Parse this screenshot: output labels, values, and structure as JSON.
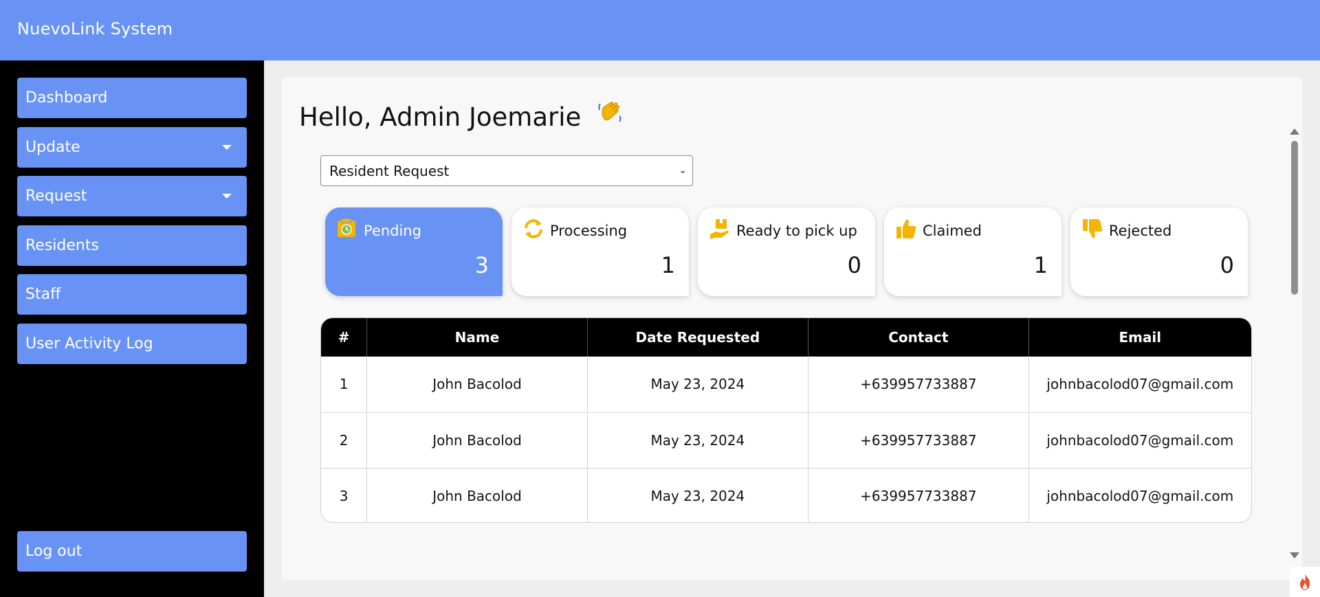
{
  "app": {
    "title": "NuevoLink System"
  },
  "sidebar": {
    "items": [
      {
        "label": "Dashboard",
        "has_caret": false
      },
      {
        "label": "Update",
        "has_caret": true
      },
      {
        "label": "Request",
        "has_caret": true
      },
      {
        "label": "Residents",
        "has_caret": false
      },
      {
        "label": "Staff",
        "has_caret": false
      },
      {
        "label": "User Activity Log",
        "has_caret": false
      }
    ],
    "logout_label": "Log out"
  },
  "main": {
    "greeting": "Hello, Admin Joemarie",
    "greeting_icon": "waving-hand-icon",
    "request_type": {
      "selected": "Resident Request"
    },
    "stats": [
      {
        "label": "Pending",
        "count": "3",
        "icon": "pending-clock-icon",
        "active": true
      },
      {
        "label": "Processing",
        "count": "1",
        "icon": "refresh-icon",
        "active": false
      },
      {
        "label": "Ready to pick up",
        "count": "0",
        "icon": "package-hand-icon",
        "active": false
      },
      {
        "label": "Claimed",
        "count": "1",
        "icon": "thumbs-up-icon",
        "active": false
      },
      {
        "label": "Rejected",
        "count": "0",
        "icon": "thumbs-down-icon",
        "active": false
      }
    ],
    "table": {
      "headers": [
        "#",
        "Name",
        "Date Requested",
        "Contact",
        "Email"
      ],
      "rows": [
        [
          "1",
          "John Bacolod",
          "May 23, 2024",
          "+639957733887",
          "johnbacolod07@gmail.com"
        ],
        [
          "2",
          "John Bacolod",
          "May 23, 2024",
          "+639957733887",
          "johnbacolod07@gmail.com"
        ],
        [
          "3",
          "John Bacolod",
          "May 23, 2024",
          "+639957733887",
          "johnbacolod07@gmail.com"
        ]
      ]
    }
  },
  "colors": {
    "accent": "#6893f5",
    "icon_yellow": "#f4b400",
    "sidebar_bg": "#000000",
    "header_row_bg": "#000000"
  }
}
